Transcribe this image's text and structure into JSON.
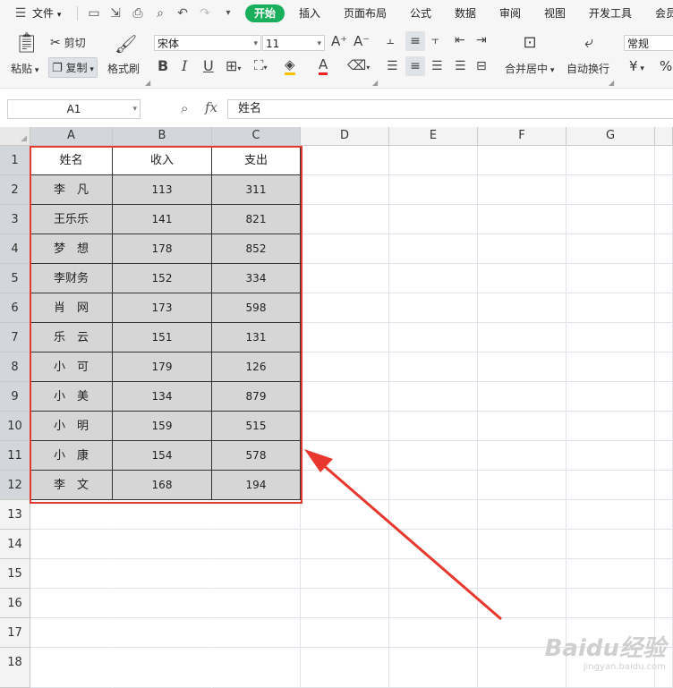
{
  "menu": {
    "file_label": "文件",
    "tabs": [
      "开始",
      "插入",
      "页面布局",
      "公式",
      "数据",
      "审阅",
      "视图",
      "开发工具",
      "会员"
    ]
  },
  "ribbon": {
    "paste_label": "粘贴",
    "cut_label": "剪切",
    "copy_label": "复制",
    "format_painter_label": "格式刷",
    "font_name": "宋体",
    "font_size": "11",
    "merge_label": "合并居中",
    "wrap_label": "自动换行",
    "number_format": "常规",
    "currency_symbol": "¥",
    "percent_symbol": "%"
  },
  "formula_bar": {
    "name_box": "A1",
    "fx": "fx",
    "content": "姓名"
  },
  "grid": {
    "columns": [
      "A",
      "B",
      "C",
      "D",
      "E",
      "F",
      "G"
    ],
    "rows": [
      "1",
      "2",
      "3",
      "4",
      "5",
      "6",
      "7",
      "8",
      "9",
      "10",
      "11",
      "12",
      "13",
      "14",
      "15",
      "16",
      "17",
      "18"
    ],
    "headers": [
      "姓名",
      "收入",
      "支出"
    ],
    "data": [
      [
        "李　凡",
        "113",
        "311"
      ],
      [
        "王乐乐",
        "141",
        "821"
      ],
      [
        "梦　想",
        "178",
        "852"
      ],
      [
        "李财务",
        "152",
        "334"
      ],
      [
        "肖　网",
        "173",
        "598"
      ],
      [
        "乐　云",
        "151",
        "131"
      ],
      [
        "小　可",
        "179",
        "126"
      ],
      [
        "小　美",
        "134",
        "879"
      ],
      [
        "小　明",
        "159",
        "515"
      ],
      [
        "小　康",
        "154",
        "578"
      ],
      [
        "李　文",
        "168",
        "194"
      ]
    ]
  },
  "colors": {
    "accent_green": "#1aaf5d",
    "highlight_red": "#e23a2f"
  },
  "watermark": "Baidu经验",
  "watermark_sub": "jingyan.baidu.com"
}
